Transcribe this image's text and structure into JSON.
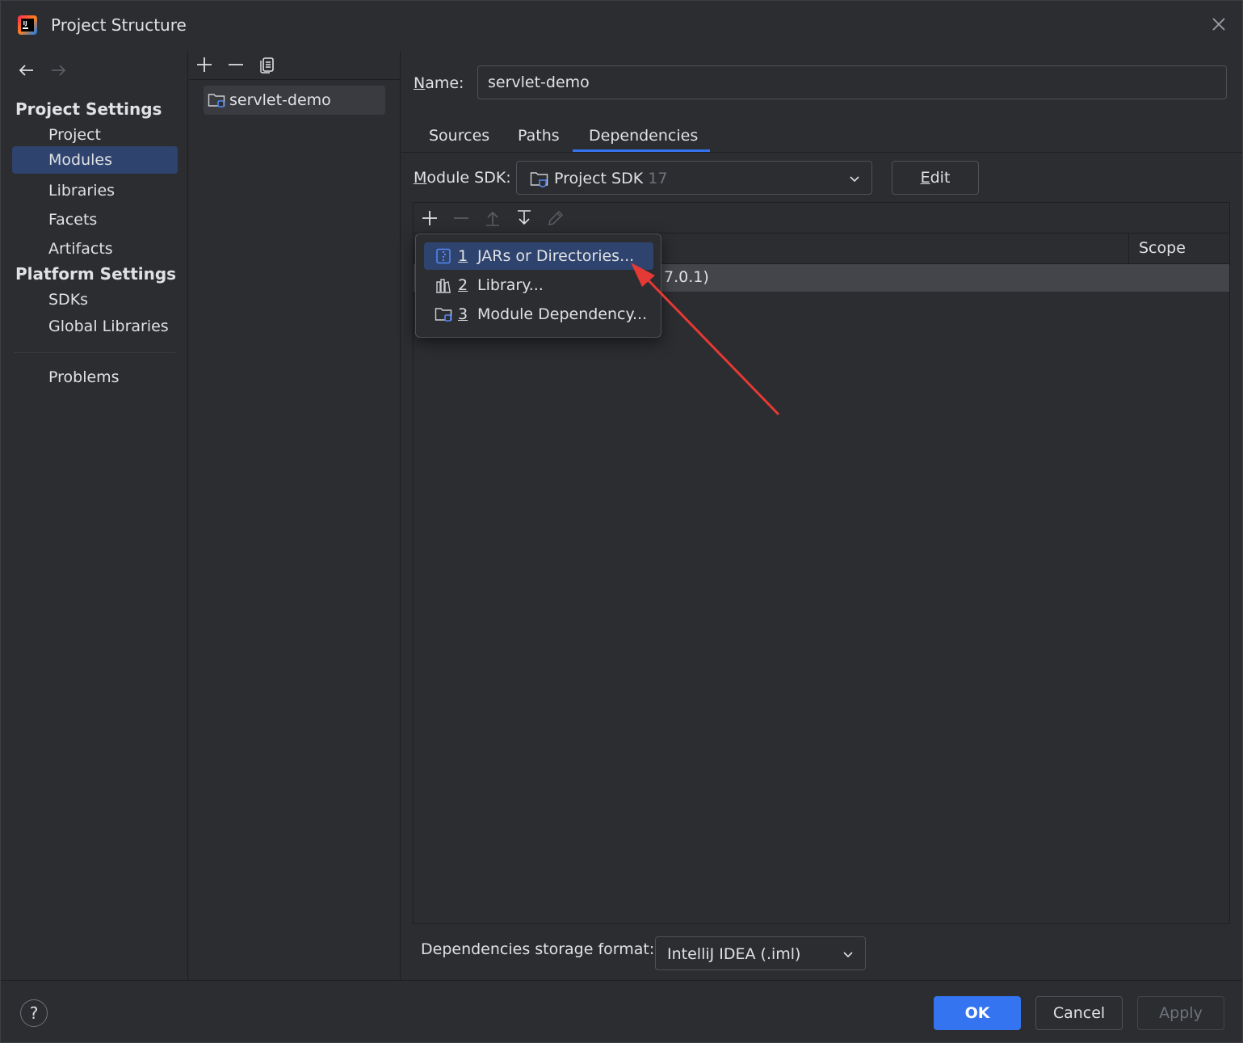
{
  "window": {
    "title": "Project Structure"
  },
  "leftnav": {
    "project_settings_title": "Project Settings",
    "project_items": [
      "Project",
      "Modules",
      "Libraries",
      "Facets",
      "Artifacts"
    ],
    "platform_settings_title": "Platform Settings",
    "platform_items": [
      "SDKs",
      "Global Libraries"
    ],
    "problems": "Problems",
    "selected": "Modules"
  },
  "modules": {
    "items": [
      "servlet-demo"
    ]
  },
  "right": {
    "name_label_first": "N",
    "name_label_rest": "ame:",
    "name_value": "servlet-demo",
    "tabs": [
      "Sources",
      "Paths",
      "Dependencies"
    ],
    "active_tab": "Dependencies",
    "sdk_label_first": "M",
    "sdk_label_rest": "odule SDK:",
    "sdk_value": "Project SDK",
    "sdk_version": "17",
    "edit_first": "E",
    "edit_rest": "dit",
    "scope_header": "Scope",
    "dependency_row_text": "7.0.1)",
    "storage_label": "Dependencies storage format:",
    "storage_value": "IntelliJ IDEA (.iml)"
  },
  "popup": {
    "items": [
      {
        "num": "1",
        "label": "JARs or Directories..."
      },
      {
        "num": "2",
        "label": "Library..."
      },
      {
        "num": "3",
        "label": "Module Dependency..."
      }
    ]
  },
  "bottom": {
    "help": "?",
    "ok": "OK",
    "cancel": "Cancel",
    "apply": "Apply"
  },
  "colors": {
    "accent": "#3574f0",
    "selection": "#2e436e",
    "background": "#2b2d30",
    "annotation_arrow": "#e53935"
  }
}
